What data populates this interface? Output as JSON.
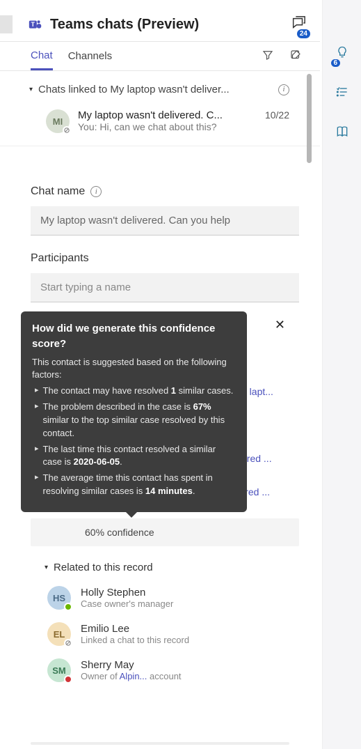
{
  "header": {
    "title": "Teams chats (Preview)",
    "compose_badge": 24
  },
  "side_rail": {
    "idea_badge": 6
  },
  "tabs": {
    "chat": "Chat",
    "channels": "Channels"
  },
  "linked_section": {
    "title": "Chats linked to My laptop wasn't deliver..."
  },
  "chat": {
    "avatar_initials": "MI",
    "title": "My laptop wasn't delivered. C...",
    "date": "10/22",
    "preview": "You: Hi, can we chat about this?"
  },
  "form": {
    "chat_name_label": "Chat name",
    "chat_name_value": "My laptop wasn't delivered. Can you help",
    "participants_label": "Participants",
    "participants_placeholder": "Start typing a name"
  },
  "tooltip": {
    "title": "How did we generate this confidence score?",
    "intro": "This contact is suggested based on the following factors:",
    "bullets": {
      "b1_pre": "The contact may have resolved ",
      "b1_bold": "1",
      "b1_post": " similar cases.",
      "b2_pre": "The problem described in the case is ",
      "b2_bold": "67%",
      "b2_post": " similar to the top similar case resolved by this contact.",
      "b3_pre": "The last time this contact resolved a similar case is ",
      "b3_bold": "2020-06-05",
      "b3_post": ".",
      "b4_pre": "The average time this contact has spent in resolving similar cases is ",
      "b4_bold": "14 minutes",
      "b4_post": "."
    }
  },
  "suggestion_hints": {
    "h1": "e lapt...",
    "h2": "ered ...",
    "h3": "ered ..."
  },
  "confidence": {
    "label": "60% confidence"
  },
  "related": {
    "title": "Related to this record",
    "contacts": [
      {
        "initials": "HS",
        "bg": "#bcd3e8",
        "fg": "#4a6a86",
        "presence": "#6bb700",
        "name": "Holly Stephen",
        "sub": "Case owner's manager",
        "link": ""
      },
      {
        "initials": "EL",
        "bg": "#f4e0b9",
        "fg": "#8a6a2e",
        "presence": "#fff",
        "name": "Emilio Lee",
        "sub": "Linked a chat to this record",
        "link": ""
      },
      {
        "initials": "SM",
        "bg": "#c6e6d2",
        "fg": "#3a7a55",
        "presence": "#d13438",
        "name": "Sherry May",
        "sub": "Owner of ",
        "link": "Alpin...",
        "sub2": " account"
      }
    ]
  }
}
